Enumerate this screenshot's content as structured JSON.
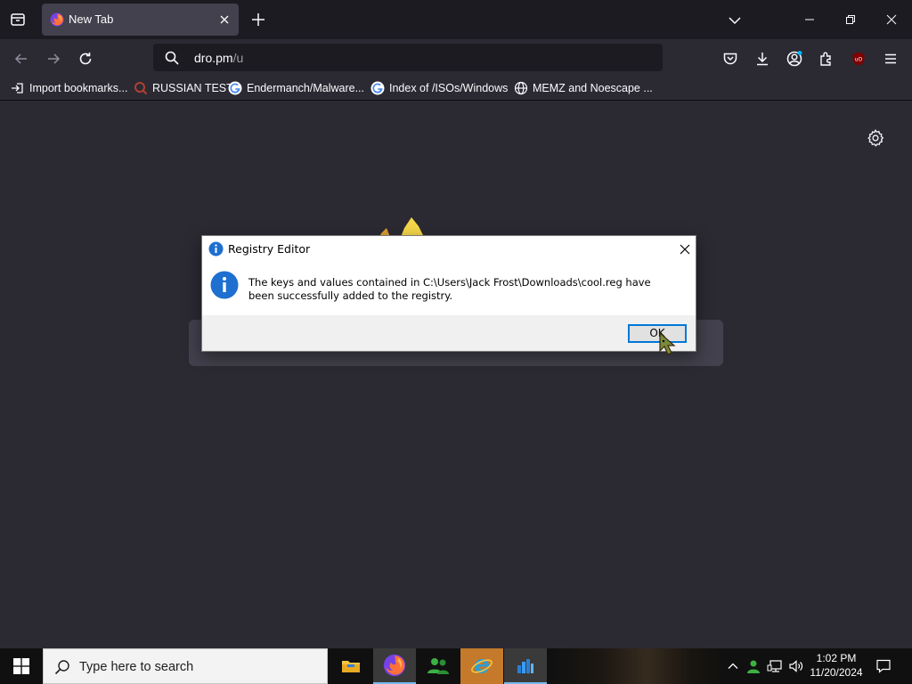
{
  "browser": {
    "tab_title": "New Tab",
    "url_host": "dro.pm",
    "url_path": "/u"
  },
  "bookmarks": [
    {
      "label": "Import bookmarks...",
      "icon": "import-icon"
    },
    {
      "label": "RUSSIAN TEST",
      "icon": "magnifier-favicon"
    },
    {
      "label": "Endermanch/Malware...",
      "icon": "google-favicon"
    },
    {
      "label": "Index of /ISOs/Windows",
      "icon": "google-favicon"
    },
    {
      "label": "MEMZ and Noescape ...",
      "icon": "globe-icon"
    }
  ],
  "dialog": {
    "title": "Registry Editor",
    "message": "The keys and values contained in C:\\Users\\Jack Frost\\Downloads\\cool.reg have been successfully added to the registry.",
    "ok_label": "OK"
  },
  "taskbar": {
    "search_placeholder": "Type here to search",
    "time": "1:02 PM",
    "date": "11/20/2024",
    "apps": [
      "file-explorer",
      "firefox",
      "people-app",
      "internet-explorer",
      "registry-editor"
    ]
  },
  "colors": {
    "accent": "#0078d7",
    "browser_bg": "#2b2a33",
    "tabstrip_bg": "#1c1b22"
  }
}
